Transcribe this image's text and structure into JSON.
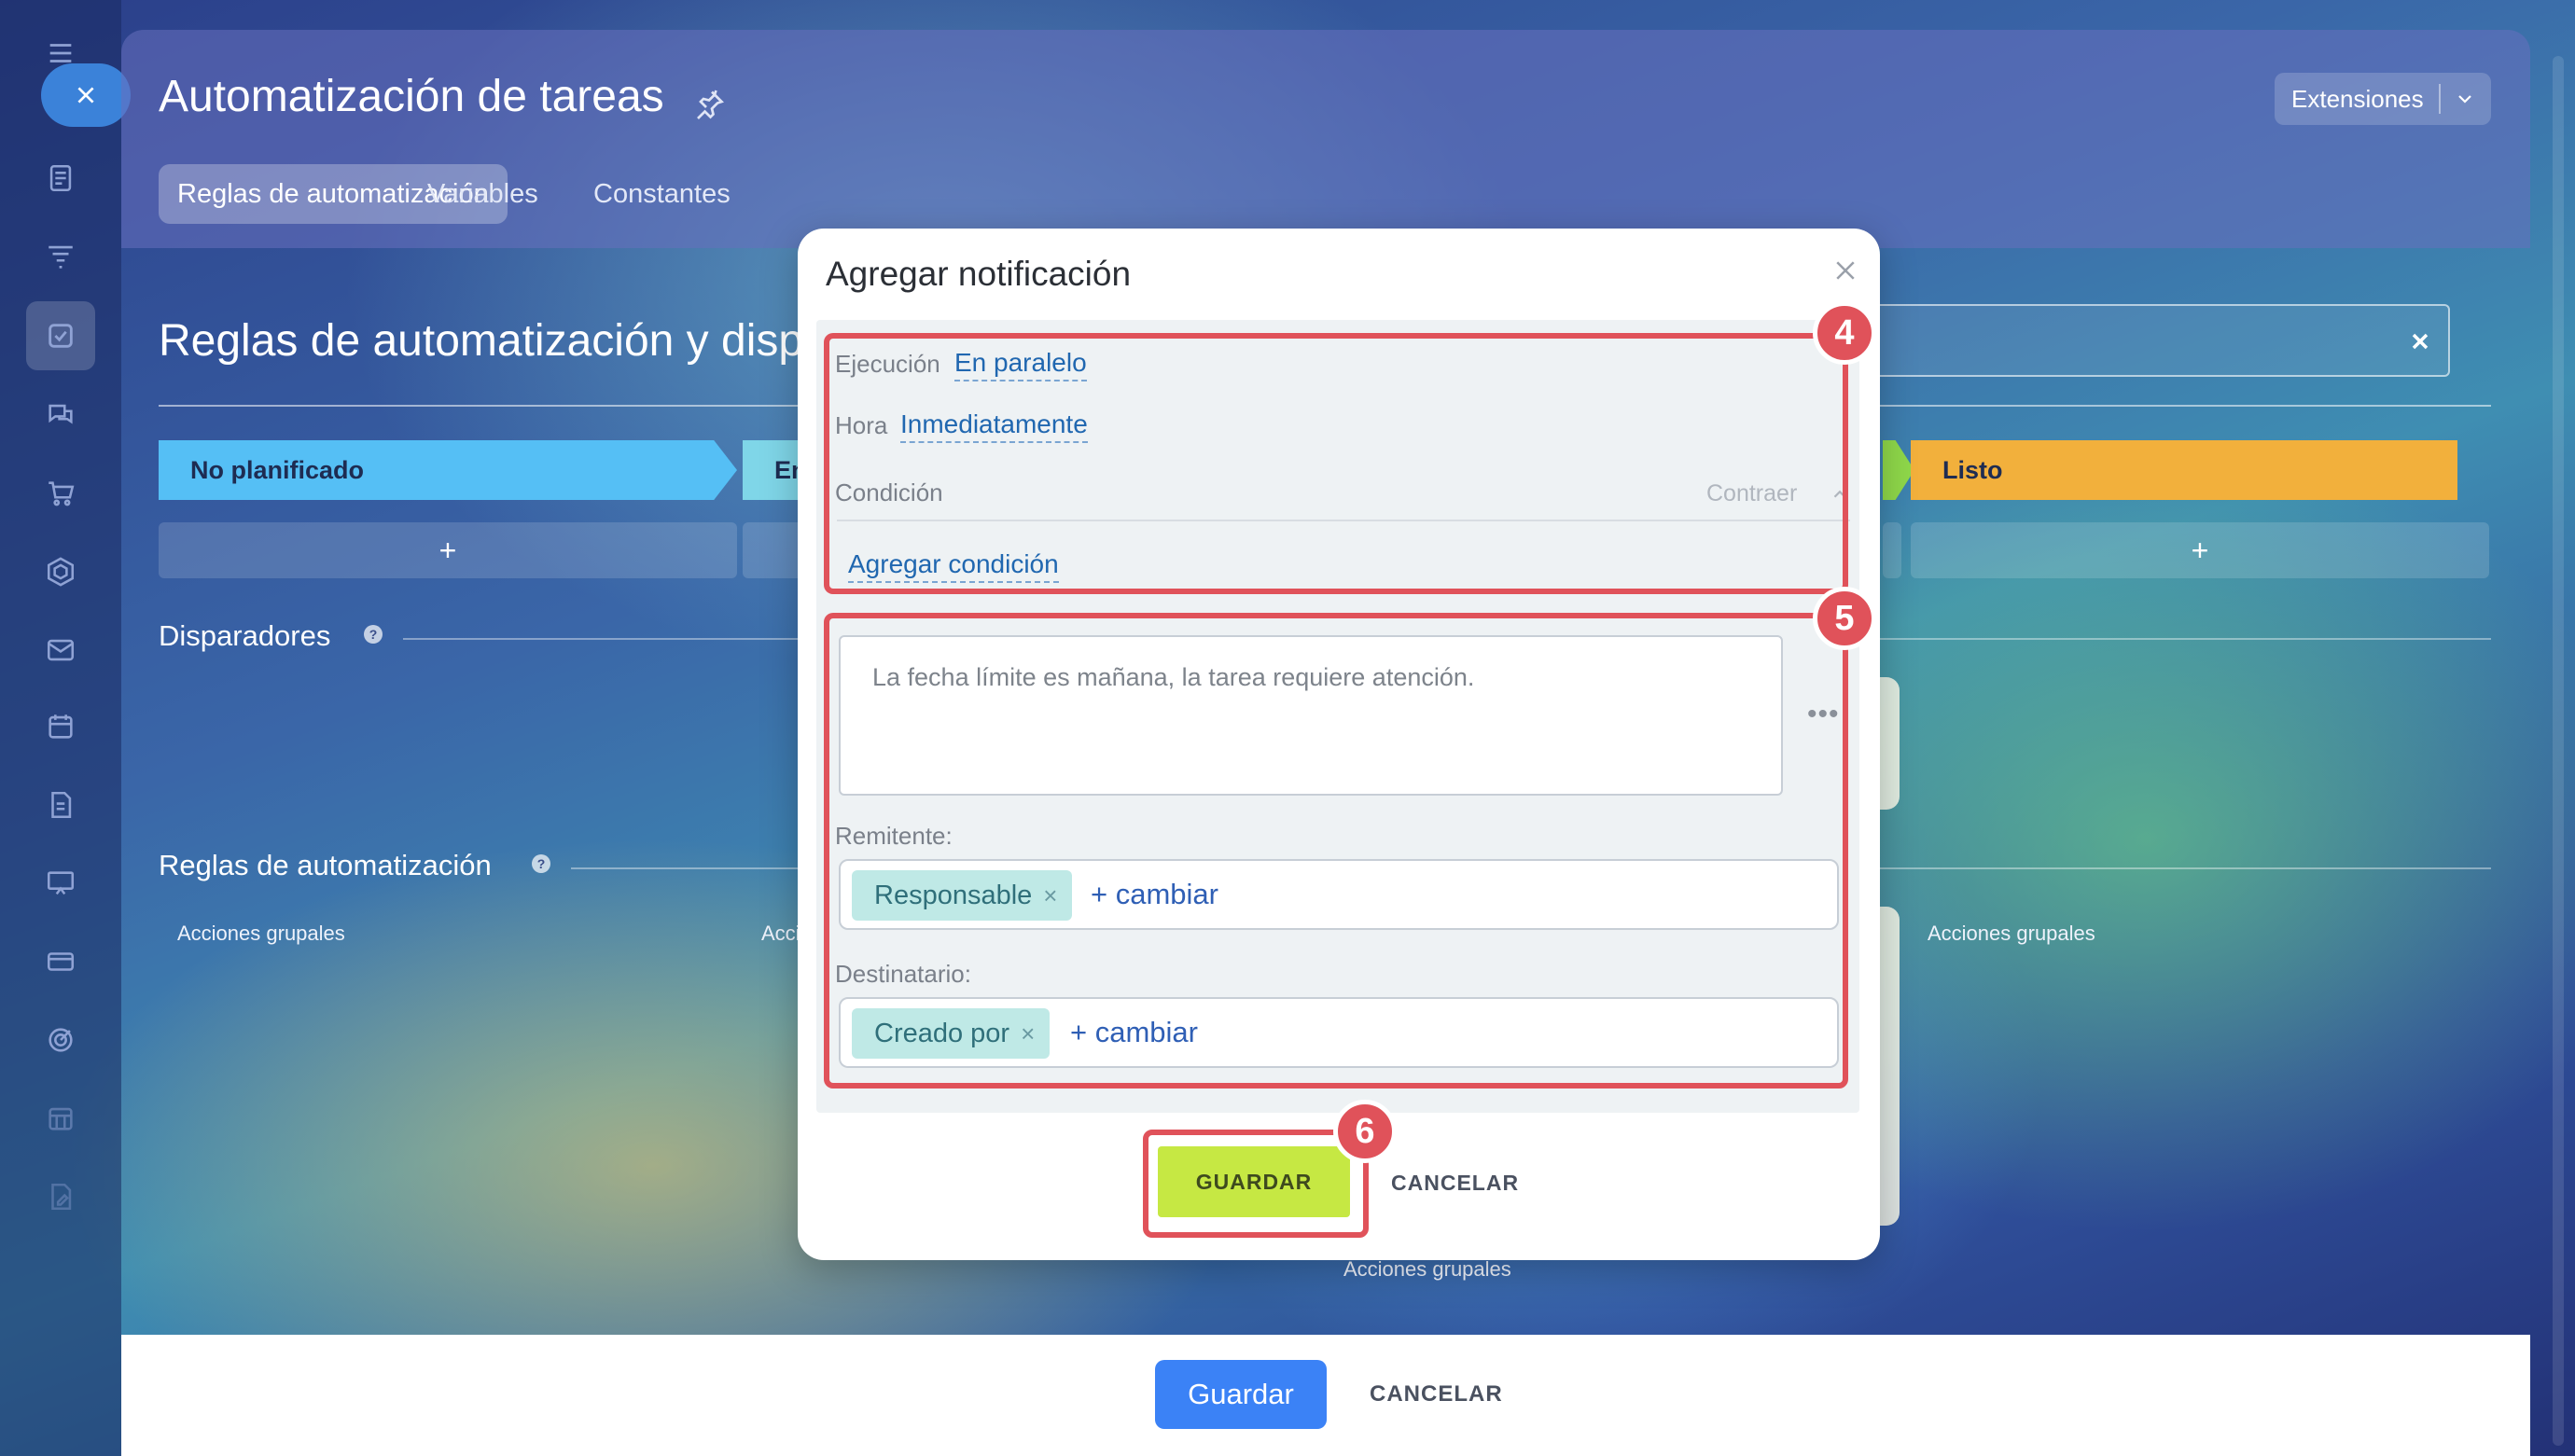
{
  "header": {
    "title": "Automatización de tareas",
    "extensions_label": "Extensiones",
    "tabs": [
      {
        "label": "Reglas de automatización",
        "active": true
      },
      {
        "label": "Variables",
        "active": false
      },
      {
        "label": "Constantes",
        "active": false
      }
    ]
  },
  "main": {
    "section_title": "Reglas de automatización y disp",
    "stages": [
      {
        "label": "No planificado",
        "color": "#55bff5"
      },
      {
        "label": "En",
        "color": "#7fd6e8"
      },
      {
        "label": "Listo",
        "color": "#f2b03c"
      }
    ],
    "add_symbol": "+",
    "triggers_title": "Disparadores",
    "rules_title": "Reglas de automatización",
    "group_actions": "Acciones grupales",
    "help_symbol": "?"
  },
  "modal": {
    "title": "Agregar notificación",
    "execution_label": "Ejecución",
    "execution_value": "En paralelo",
    "time_label": "Hora",
    "time_value": "Inmediatamente",
    "condition_label": "Condición",
    "collapse_label": "Contraer",
    "add_condition_label": "Agregar condición",
    "message_text": "La fecha límite es mañana, la tarea requiere atención.",
    "more_label": "•••",
    "sender_label": "Remitente:",
    "sender_chip": "Responsable",
    "recipient_label": "Destinatario:",
    "recipient_chip": "Creado por",
    "change_link": "+ cambiar",
    "chip_remove": "×",
    "save_label": "GUARDAR",
    "cancel_label": "CANCELAR"
  },
  "footer": {
    "save_label": "Guardar",
    "cancel_label": "CANCELAR"
  },
  "annotations": {
    "badge_4": "4",
    "badge_5": "5",
    "badge_6": "6",
    "highlight_color": "#e0525a"
  },
  "sidebar": {
    "icons": [
      "menu-icon",
      "feed-icon",
      "filter-icon",
      "tasks-icon",
      "chat-icon",
      "cart-icon",
      "hexagon-icon",
      "mail-icon",
      "calendar-icon",
      "document-icon",
      "board-icon",
      "card-icon",
      "target-icon",
      "grid-calendar-icon",
      "edit-doc-icon"
    ]
  }
}
